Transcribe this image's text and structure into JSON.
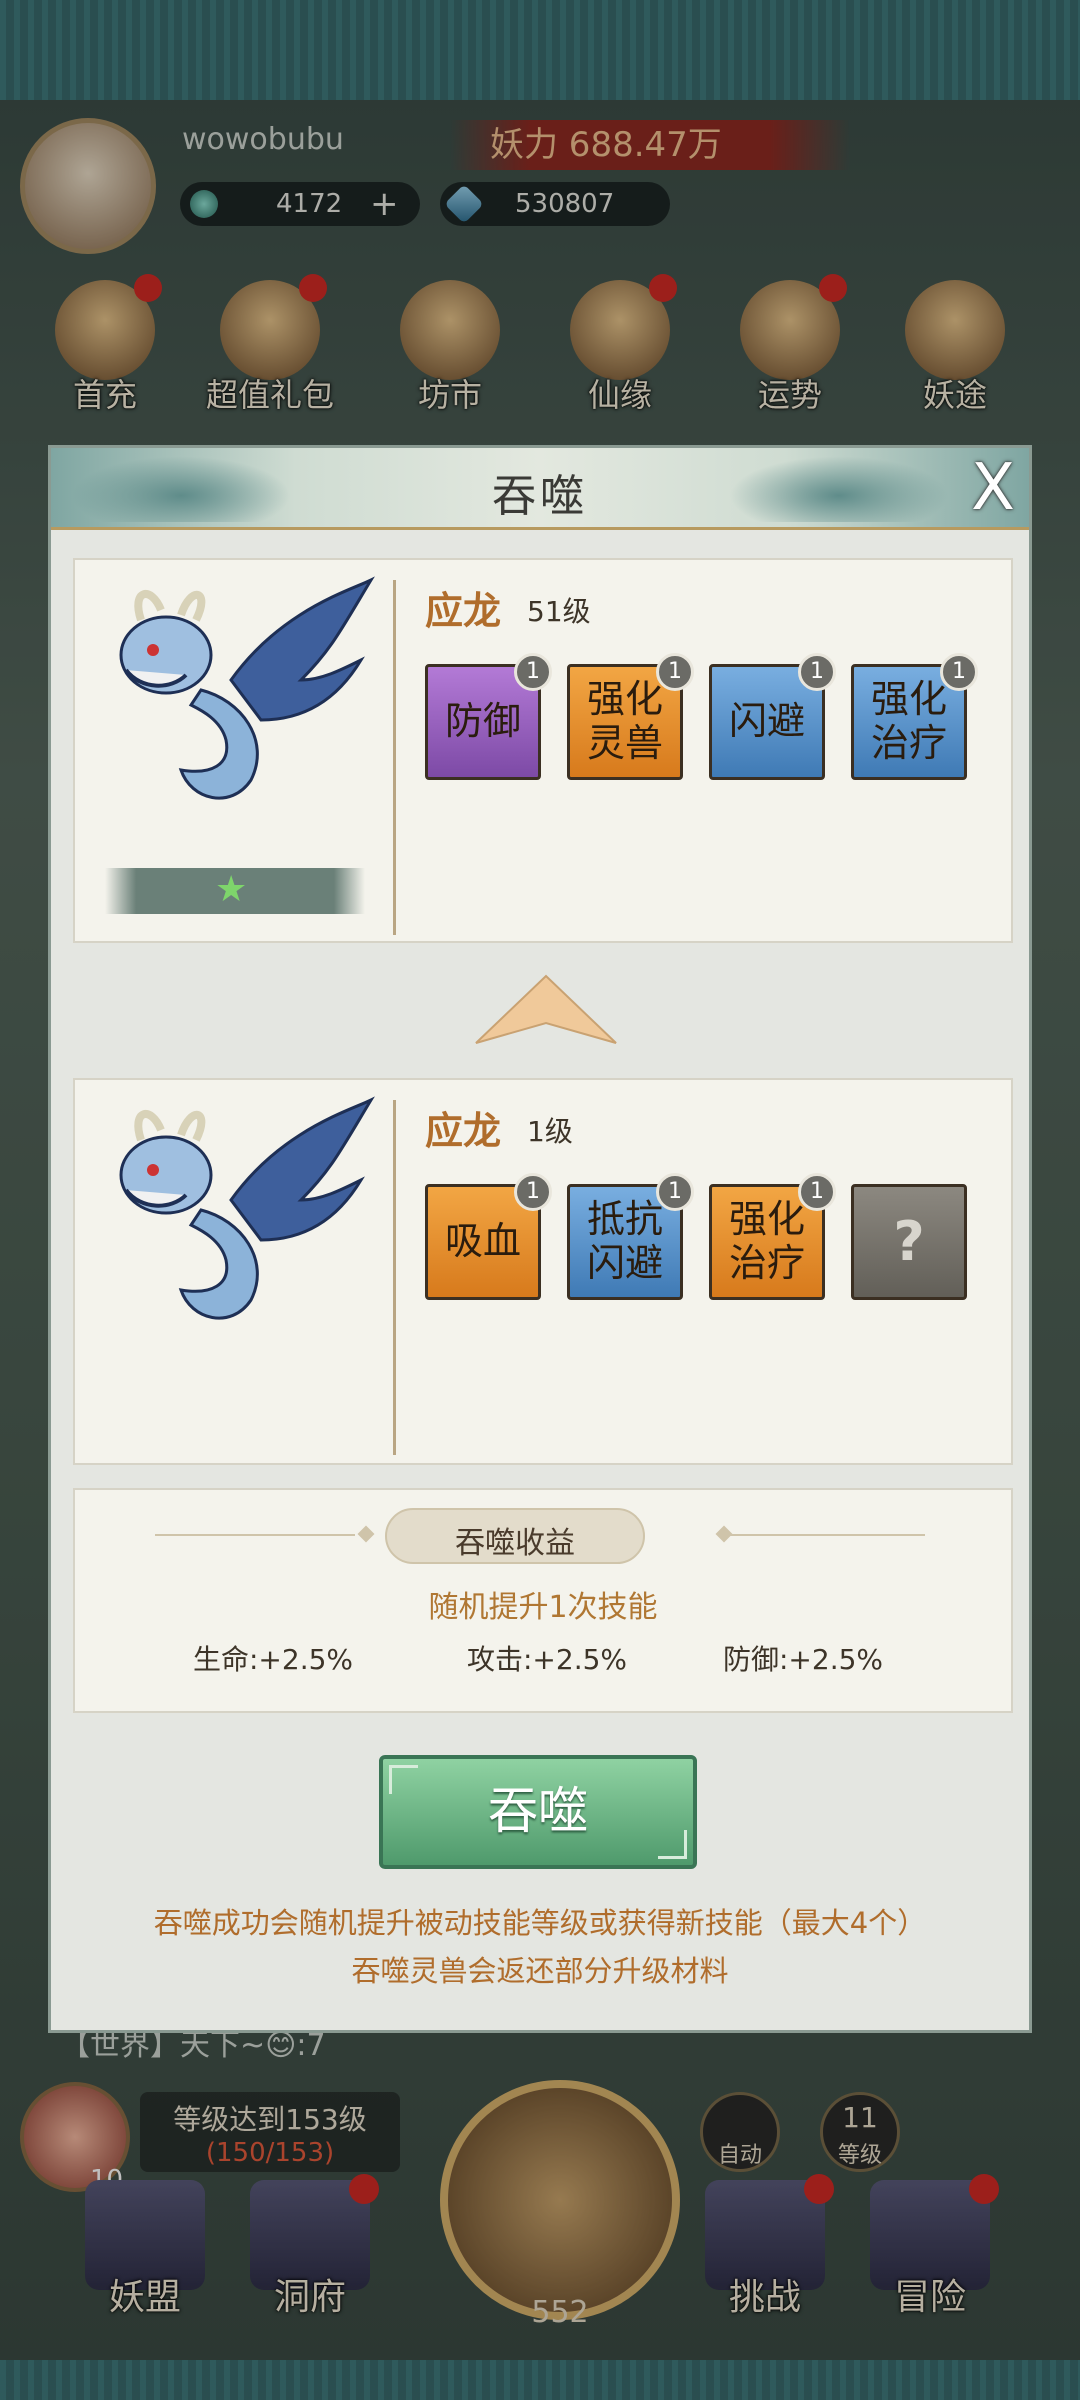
{
  "hud": {
    "username": "wowobubu",
    "power": "妖力 688.47万",
    "jade": "4172",
    "jade_plus": "+",
    "crystal": "530807",
    "icons": [
      {
        "label": "首充"
      },
      {
        "label": "超值礼包"
      },
      {
        "label": "坊市"
      },
      {
        "label": "仙缘"
      },
      {
        "label": "运势"
      },
      {
        "label": "妖途"
      }
    ],
    "chat": "【世界】天下~😊:7",
    "level_goal": "等级达到153级",
    "level_progress": "(150/153)",
    "peach_count": "10",
    "axe_count": "552",
    "auto_label": "自动",
    "grade_num": "11",
    "grade_label": "等级",
    "nav": [
      {
        "label": "妖盟"
      },
      {
        "label": "洞府"
      },
      {
        "label": "挑战"
      },
      {
        "label": "冒险"
      }
    ]
  },
  "dialog": {
    "title": "吞噬",
    "close": "X",
    "target": {
      "name": "应龙",
      "level": "51级",
      "stars": 1,
      "skills": [
        {
          "name": "防御",
          "level": "1",
          "color": "purple"
        },
        {
          "name": "强化\n灵兽",
          "level": "1",
          "color": "orange"
        },
        {
          "name": "闪避",
          "level": "1",
          "color": "blue"
        },
        {
          "name": "强化\n治疗",
          "level": "1",
          "color": "blue"
        }
      ]
    },
    "material": {
      "name": "应龙",
      "level": "1级",
      "skills": [
        {
          "name": "吸血",
          "level": "1",
          "color": "orange"
        },
        {
          "name": "抵抗\n闪避",
          "level": "1",
          "color": "blue"
        },
        {
          "name": "强化\n治疗",
          "level": "1",
          "color": "orange"
        },
        {
          "name": "?",
          "level": "",
          "color": "grey"
        }
      ]
    },
    "gain": {
      "title": "吞噬收益",
      "desc": "随机提升1次技能",
      "hp": "生命:+2.5%",
      "atk": "攻击:+2.5%",
      "def": "防御:+2.5%"
    },
    "button": "吞噬",
    "note1": "吞噬成功会随机提升被动技能等级或获得新技能（最大4个）",
    "note2": "吞噬灵兽会返还部分升级材料"
  }
}
